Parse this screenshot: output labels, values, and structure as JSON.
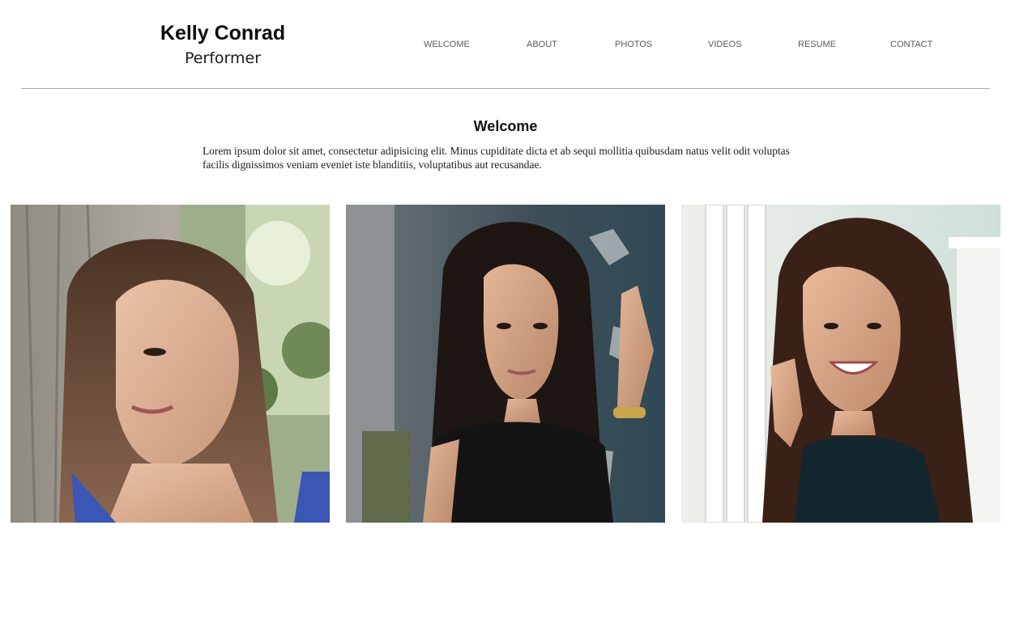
{
  "header": {
    "name": "Kelly Conrad",
    "tagline": "Performer"
  },
  "nav": {
    "items": [
      {
        "label": "WELCOME"
      },
      {
        "label": "ABOUT"
      },
      {
        "label": "PHOTOS"
      },
      {
        "label": "VIDEOS"
      },
      {
        "label": "RESUME"
      },
      {
        "label": "CONTACT"
      }
    ]
  },
  "main": {
    "title": "Welcome",
    "intro": "Lorem ipsum dolor sit amet, consectetur adipisicing elit. Minus cupiditate dicta et ab sequi mollitia quibusdam natus velit odit voluptas facilis dignissimos veniam eveniet iste blanditiis, voluptatibus aut recusandae."
  },
  "gallery": {
    "photos": [
      {
        "subject": "headshot-profile-tree"
      },
      {
        "subject": "portrait-weathered-wall"
      },
      {
        "subject": "smiling-portrait-window"
      }
    ]
  },
  "colors": {
    "text": "#111111",
    "nav_text": "#5a5a5a",
    "rule": "#a8a8a8",
    "background": "#ffffff"
  }
}
